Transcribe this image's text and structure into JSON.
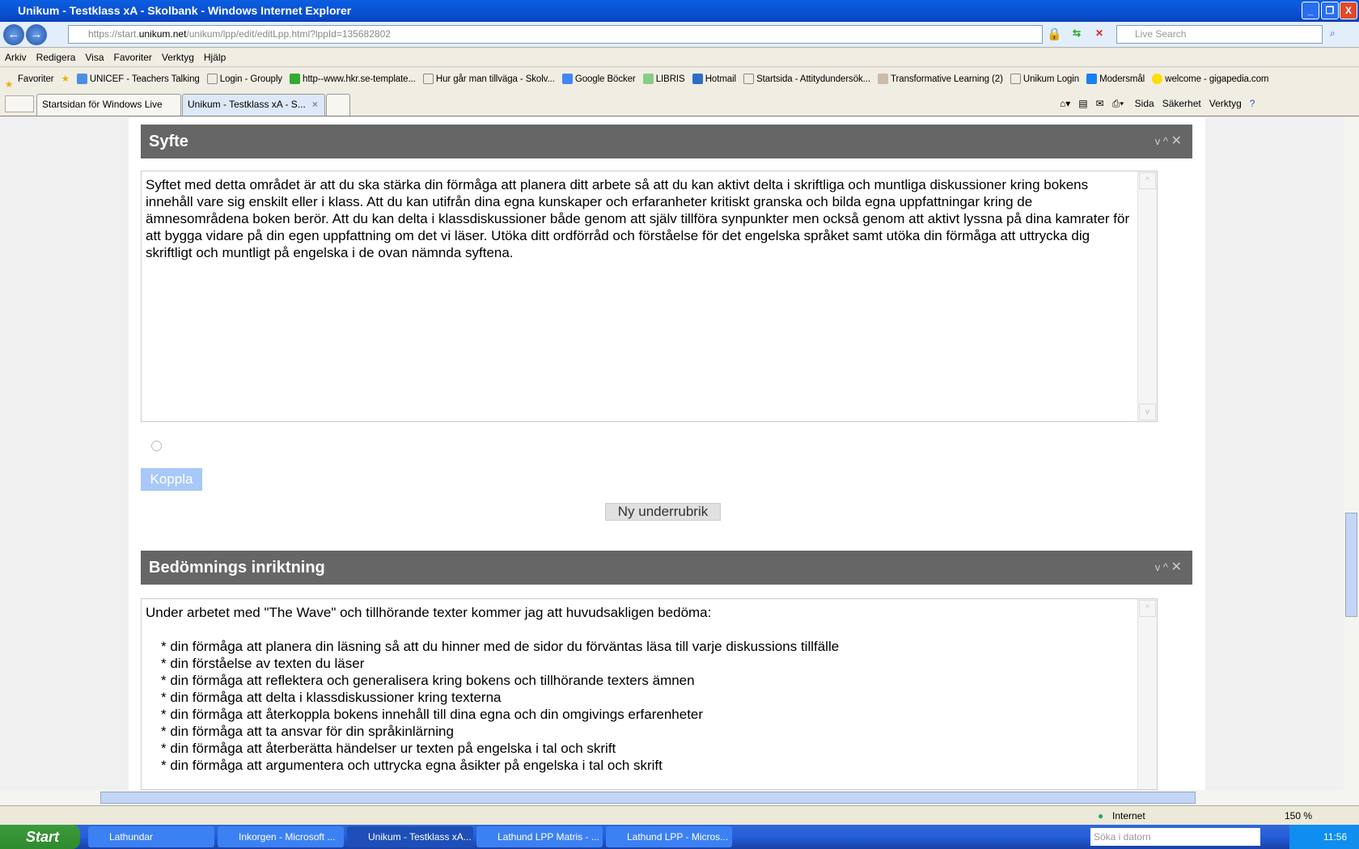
{
  "window": {
    "title": "Unikum - Testklass xA - Skolbank - Windows Internet Explorer",
    "minimize": "_",
    "restore": "❐",
    "close": "X"
  },
  "address": {
    "url_prefix": "https://start.",
    "url_domain": "unikum.net",
    "url_path": "/unikum/lpp/edit/editLpp.html?lppId=135682802",
    "search_placeholder": "Live Search"
  },
  "menu": [
    "Arkiv",
    "Redigera",
    "Visa",
    "Favoriter",
    "Verktyg",
    "Hjälp"
  ],
  "favorites": {
    "label": "Favoriter",
    "items": [
      "UNICEF - Teachers Talking",
      "Login - Grouply",
      "http--www.hkr.se-template...",
      "Hur går man tillväga - Skolv...",
      "Google Böcker",
      "LIBRIS",
      "Hotmail",
      "Startsida - Attitydundersök...",
      "Transformative Learning (2)",
      "Unikum Login",
      "Modersmål",
      "welcome - gigapedia.com"
    ]
  },
  "tabs": [
    {
      "label": "Startsidan för Windows Live"
    },
    {
      "label": "Unikum - Testklass xA - S...",
      "active": true
    }
  ],
  "command_bar": [
    "Sida",
    "Säkerhet",
    "Verktyg"
  ],
  "sections": [
    {
      "title": "Syfte",
      "controls": {
        "down": "v",
        "up": "^",
        "close": "✕"
      },
      "text": "Syftet med detta området är att du ska stärka din förmåga att planera ditt arbete så att du kan aktivt delta i skriftliga och muntliga diskussioner kring bokens innehåll vare sig enskilt eller i klass.  Att du kan utifrån dina egna kunskaper och erfaranheter kritiskt granska och bilda egna uppfattningar kring de ämnesområdena boken berör.  Att du kan delta i klassdiskussioner både genom att själv tillföra synpunkter men också genom att aktivt lyssna på dina kamrater för att bygga vidare på din egen uppfattning om det vi läser.  Utöka ditt ordförråd och förståelse för det engelska språket samt utöka din förmåga att uttrycka dig skriftligt och muntligt på engelska i de ovan nämnda syftena."
    },
    {
      "title": "Bedömnings inriktning",
      "controls": {
        "down": "v",
        "up": "^",
        "close": "✕"
      },
      "intro": "Under arbetet med \"The Wave\" och tillhörande texter kommer jag att huvudsakligen bedöma:",
      "bullets": [
        "* din förmåga att planera din läsning så att du hinner med de sidor du förväntas läsa till varje diskussions tillfälle",
        "* din förståelse av texten du läser",
        "* din förmåga att reflektera och generalisera kring bokens och tillhörande texters ämnen",
        "* din förmåga att delta i klassdiskussioner kring texterna",
        "* din förmåga att återkoppla bokens innehåll till dina egna och din omgivings erfarenheter",
        "* din förmåga att ta ansvar för din språkinlärning",
        "* din förmåga att återberätta händelser ur texten på engelska i tal och skrift",
        "* din förmåga att argumentera och uttrycka egna åsikter på engelska i tal och skrift"
      ]
    }
  ],
  "buttons": {
    "koppla": "Koppla",
    "ny_underrubrik": "Ny underrubrik"
  },
  "status": {
    "zone": "Internet",
    "zoom": "150 %"
  },
  "taskbar": {
    "start": "Start",
    "items": [
      "Lathundar",
      "Inkorgen - Microsoft ...",
      "Unikum - Testklass xA...",
      "Lathund LPP Matris - ...",
      "Lathund LPP - Micros..."
    ],
    "search_placeholder": "Söka i datorn",
    "clock": "11:56"
  },
  "colors": {
    "section_header": "#666666",
    "koppla_button": "#a8c8f8",
    "titlebar": "#0a5fe0"
  }
}
